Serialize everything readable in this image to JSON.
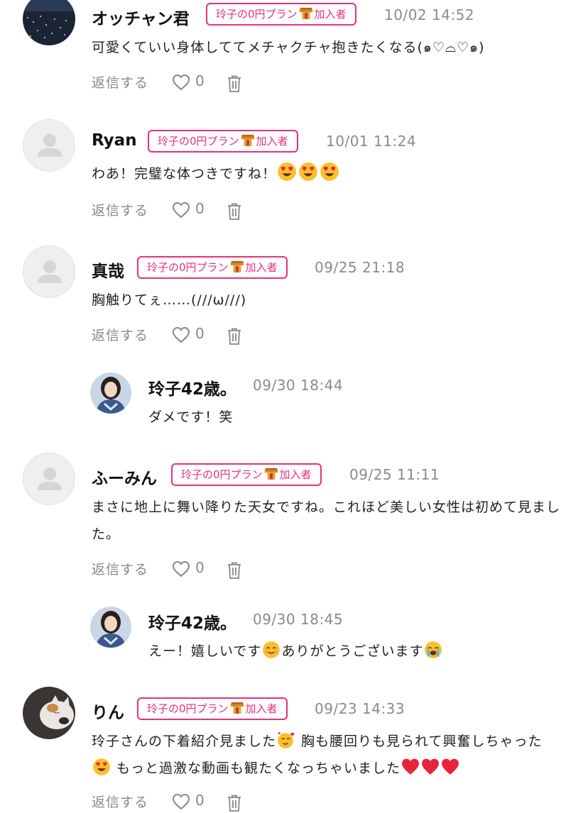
{
  "badge_label": {
    "pre": "玲子の0円プラン",
    "post": "加入者"
  },
  "reply_label": "返信する",
  "colors": {
    "accent": "#e8317a",
    "muted": "#888888",
    "avatar_bg": "#efefef"
  },
  "comments": [
    {
      "name": "オッチャン君",
      "time": "10/02 14:52",
      "text": "可愛くていい身体しててメチャクチャ抱きたくなる(๑♡⌓♡๑)",
      "likes": "0"
    },
    {
      "name": "Ryan",
      "time": "10/01 11:24",
      "text": "わあ！完璧な体つきですね！",
      "likes": "0"
    },
    {
      "name": "真哉",
      "time": "09/25 21:18",
      "text": "胸触りてぇ……(///ω///)",
      "likes": "0",
      "reply": {
        "name": "玲子42歳。",
        "time": "09/30 18:44",
        "text": "ダメです！笑"
      }
    },
    {
      "name": "ふーみん",
      "time": "09/25 11:11",
      "text": "まさに地上に舞い降りた天女ですね。これほど美しい女性は初めて見ました。",
      "likes": "0",
      "reply": {
        "name": "玲子42歳。",
        "time": "09/30 18:45",
        "text_a": "えー！嬉しいです",
        "text_b": "ありがとうございます"
      }
    },
    {
      "name": "りん",
      "time": "09/23 14:33",
      "text_a": "玲子さんの下着紹介見ました",
      "text_b": " 胸も腰回りも見られて興奮しちゃった",
      "text_c": " もっと過激な動画も観たくなっちゃいました",
      "likes": "0"
    }
  ],
  "icons": [
    "heart-icon",
    "trash-icon",
    "badge-icon",
    "default-avatar-icon",
    "heart-eyes-emoji",
    "smiling-emoji",
    "crying-emoji",
    "red-heart-emoji",
    "hearts-face-emoji"
  ]
}
